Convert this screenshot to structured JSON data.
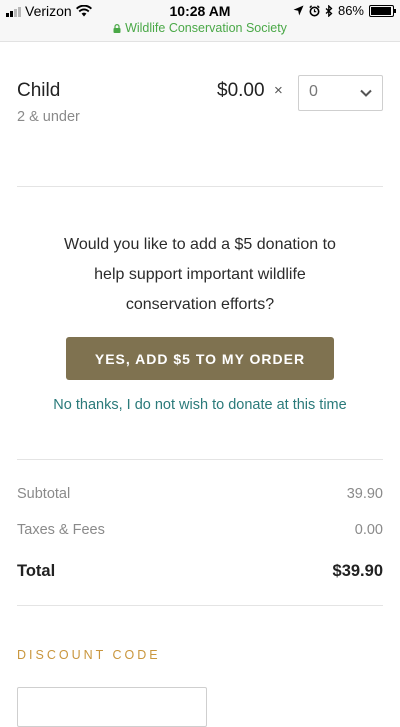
{
  "status_bar": {
    "carrier": "Verizon",
    "time": "10:28 AM",
    "battery": "86%",
    "site": "Wildlife Conservation Society"
  },
  "ticket": {
    "name": "Child",
    "sub": "2 & under",
    "price": "$0.00",
    "times": "×",
    "quantity": "0"
  },
  "donation": {
    "line1": "Would you like to add a $5 donation to",
    "line2": "help support important wildlife",
    "line3": "conservation efforts?",
    "accept_label": "YES, ADD $5 TO MY ORDER",
    "decline_label": "No thanks, I do not wish to donate at this time"
  },
  "summary": {
    "subtotal_label": "Subtotal",
    "subtotal_value": "39.90",
    "taxes_label": "Taxes & Fees",
    "taxes_value": "0.00",
    "total_label": "Total",
    "total_value": "$39.90"
  },
  "discount": {
    "label": "DISCOUNT CODE",
    "value": ""
  },
  "colors": {
    "accent_button": "#7f7250",
    "link": "#2a7a7a",
    "discount_label": "#c9963d",
    "site_url": "#4aa847"
  }
}
